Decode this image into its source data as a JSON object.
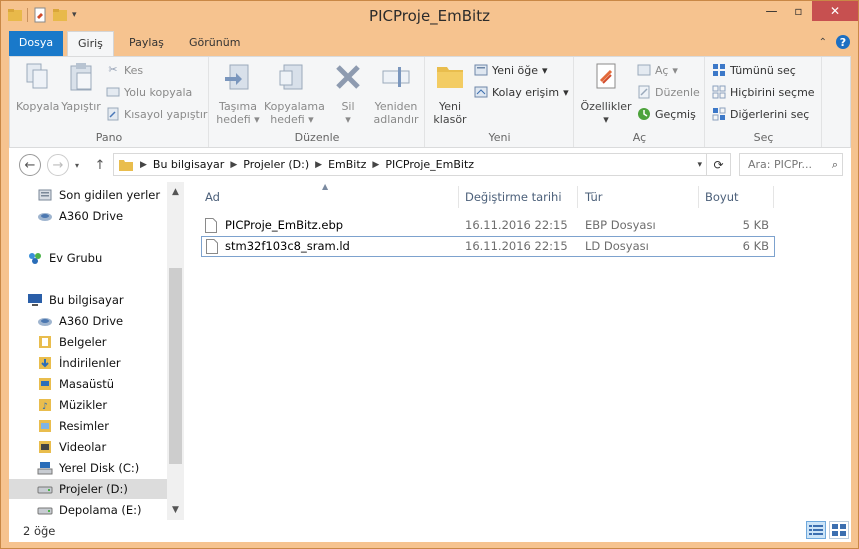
{
  "window": {
    "title": "PICProje_EmBitz"
  },
  "ribbon_tabs": [
    {
      "label": "Dosya"
    },
    {
      "label": "Giriş"
    },
    {
      "label": "Paylaş"
    },
    {
      "label": "Görünüm"
    }
  ],
  "ribbon": {
    "pano": {
      "title": "Pano",
      "kopyala": "Kopyala",
      "yapistir": "Yapıştır",
      "kes": "Kes",
      "yolu_kopyala": "Yolu kopyala",
      "kisayol_yapistir": "Kısayol yapıştır"
    },
    "duzenle": {
      "title": "Düzenle",
      "tasima_hedefi_1": "Taşıma",
      "tasima_hedefi_2": "hedefi",
      "kopyalama_hedefi_1": "Kopyalama",
      "kopyalama_hedefi_2": "hedefi",
      "sil": "Sil",
      "yeniden_1": "Yeniden",
      "yeniden_2": "adlandır"
    },
    "yeni": {
      "title": "Yeni",
      "yeni_klasor_1": "Yeni",
      "yeni_klasor_2": "klasör",
      "yeni_oge": "Yeni öğe",
      "kolay_erisim": "Kolay erişim"
    },
    "ac": {
      "title": "Aç",
      "ozellikler": "Özellikler",
      "ac": "Aç",
      "duzenle": "Düzenle",
      "gecmis": "Geçmiş"
    },
    "sec": {
      "title": "Seç",
      "tumunu_sec": "Tümünü seç",
      "hicbirini_secme": "Hiçbirini seçme",
      "digerlerini_sec": "Diğerlerini seç"
    }
  },
  "address": {
    "crumbs": [
      "Bu bilgisayar",
      "Projeler (D:)",
      "EmBitz",
      "PICProje_EmBitz"
    ],
    "search_placeholder": "Ara: PICPr..."
  },
  "nav_pane": {
    "items": [
      {
        "label": "Son gidilen yerler",
        "icon": "recent-places-icon"
      },
      {
        "label": "A360 Drive",
        "icon": "cloud-drive-icon"
      },
      {
        "label": "Ev Grubu",
        "icon": "homegroup-icon"
      },
      {
        "label": "Bu bilgisayar",
        "icon": "computer-icon"
      },
      {
        "label": "A360 Drive",
        "icon": "cloud-drive-icon"
      },
      {
        "label": "Belgeler",
        "icon": "documents-icon"
      },
      {
        "label": "İndirilenler",
        "icon": "downloads-icon"
      },
      {
        "label": "Masaüstü",
        "icon": "desktop-icon"
      },
      {
        "label": "Müzikler",
        "icon": "music-icon"
      },
      {
        "label": "Resimler",
        "icon": "pictures-icon"
      },
      {
        "label": "Videolar",
        "icon": "videos-icon"
      },
      {
        "label": "Yerel Disk (C:)",
        "icon": "system-drive-icon"
      },
      {
        "label": "Projeler (D:)",
        "icon": "drive-icon",
        "selected": true
      },
      {
        "label": "Depolama (E:)",
        "icon": "drive-icon"
      }
    ]
  },
  "file_list": {
    "columns": [
      "Ad",
      "Değiştirme tarihi",
      "Tür",
      "Boyut"
    ],
    "rows": [
      {
        "name": "PICProje_EmBitz.ebp",
        "date": "16.11.2016 22:15",
        "type": "EBP Dosyası",
        "size": "5 KB"
      },
      {
        "name": "stm32f103c8_sram.ld",
        "date": "16.11.2016 22:15",
        "type": "LD Dosyası",
        "size": "6 KB"
      }
    ]
  },
  "status": {
    "item_count": "2 öğe"
  },
  "colors": {
    "frame": "#f6c38f",
    "file_tab": "#1979ca",
    "close": "#c75050"
  }
}
